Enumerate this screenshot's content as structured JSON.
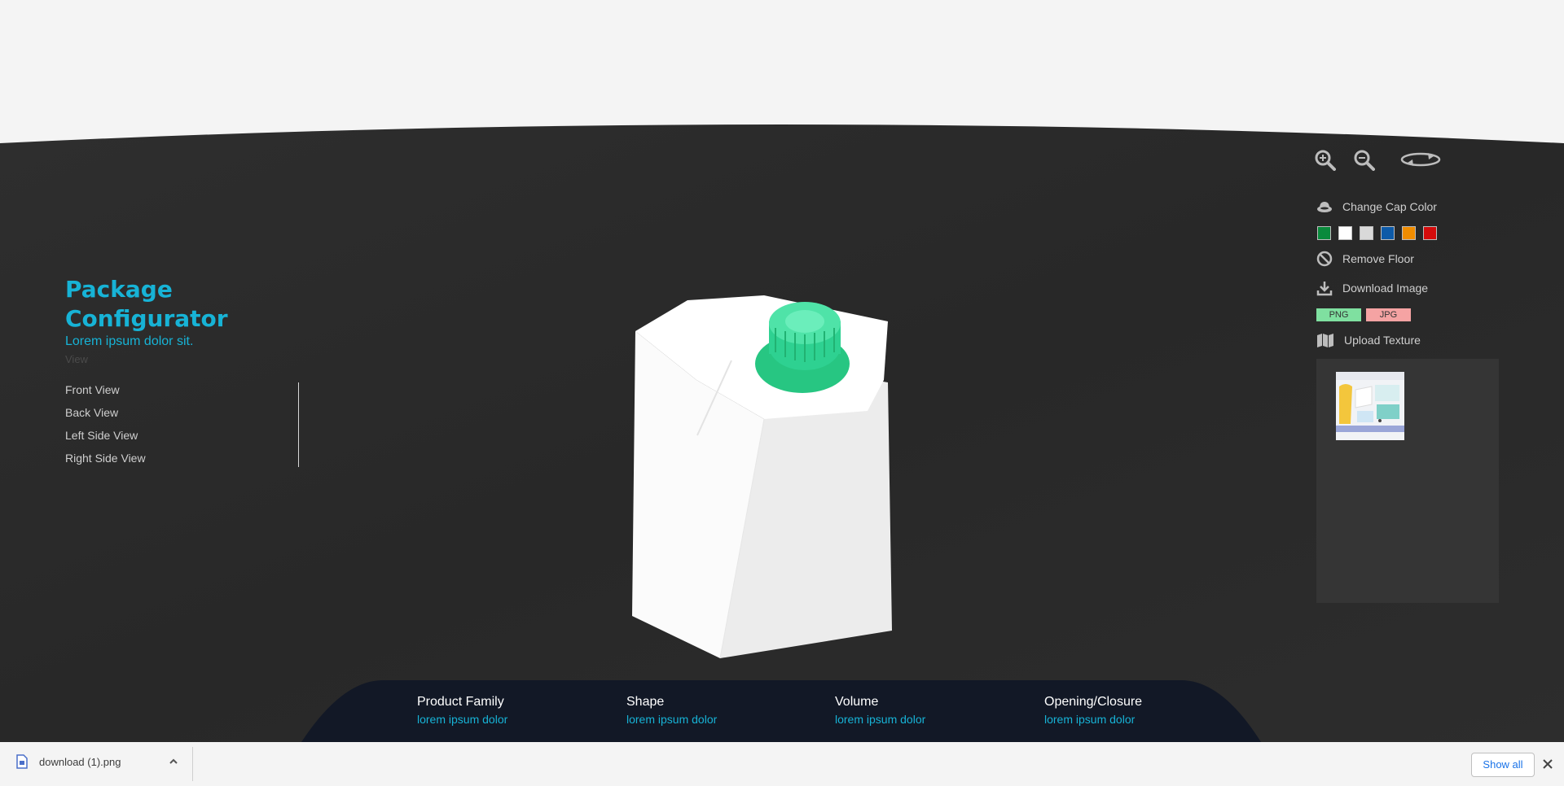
{
  "brand": {
    "title": "Package Configurator",
    "subtitle": "Lorem ipsum dolor sit.",
    "view_caption": "View"
  },
  "views": [
    "Front View",
    "Back View",
    "Left Side View",
    "Right Side View"
  ],
  "controls": {
    "zoom_in": "zoom-in-icon",
    "zoom_out": "zoom-out-icon",
    "rotate": "rotate-icon"
  },
  "options": {
    "cap_color_label": "Change Cap Color",
    "remove_floor_label": "Remove Floor",
    "download_label": "Download Image",
    "png_label": "PNG",
    "jpg_label": "JPG",
    "upload_label": "Upload Texture"
  },
  "cap_colors": [
    "#0a8a3c",
    "#ffffff",
    "#d9d9d9",
    "#0d5aa8",
    "#f08c00",
    "#d40c0c"
  ],
  "product_cap_color": "#2ed191",
  "info": [
    {
      "label": "Product Family",
      "value": "lorem ipsum dolor"
    },
    {
      "label": "Shape",
      "value": "lorem ipsum dolor"
    },
    {
      "label": "Volume",
      "value": "lorem ipsum dolor"
    },
    {
      "label": "Opening/Closure",
      "value": "lorem ipsum dolor"
    }
  ],
  "download_bar": {
    "file_name": "download (1).png",
    "show_all": "Show all"
  },
  "colors": {
    "accent": "#17b3d6",
    "stage": "#2b2b2b",
    "info_bar": "#121826",
    "png_button": "#7fe0a0",
    "jpg_button": "#f5a3a3"
  }
}
